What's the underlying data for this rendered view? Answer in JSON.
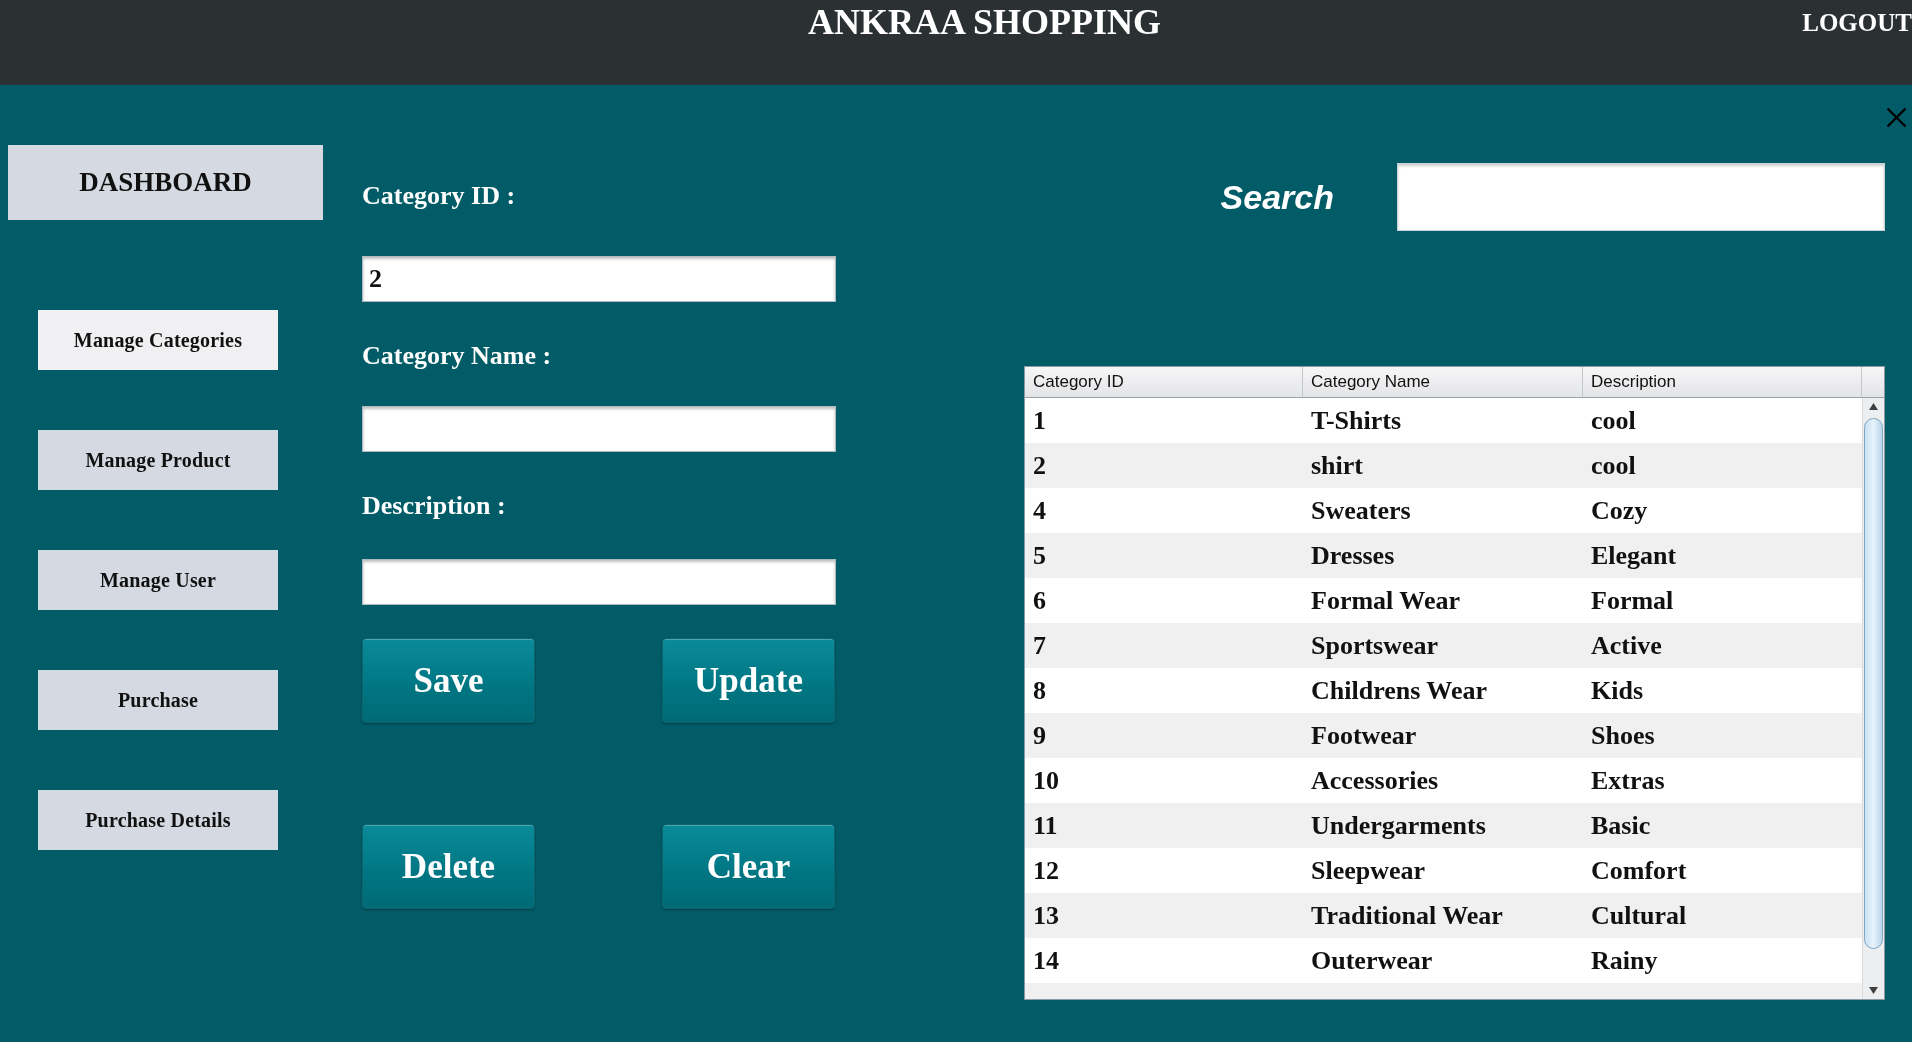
{
  "header": {
    "title": "ANKRAA SHOPPING",
    "logout": "LOGOUT"
  },
  "sidebar": {
    "dashboard": "DASHBOARD",
    "items": [
      {
        "label": "Manage Categories",
        "selected": true
      },
      {
        "label": "Manage Product",
        "selected": false
      },
      {
        "label": "Manage User",
        "selected": false
      },
      {
        "label": "Purchase",
        "selected": false
      },
      {
        "label": "Purchase Details",
        "selected": false
      }
    ]
  },
  "form": {
    "fields": [
      {
        "label": "Category ID :",
        "value": "2"
      },
      {
        "label": "Category Name :"
      },
      {
        "label": "Description :"
      }
    ],
    "buttons": [
      "Save",
      "Update",
      "Delete",
      "Clear"
    ]
  },
  "search": {
    "label": "Search"
  },
  "table": {
    "columns": [
      "Category ID",
      "Category Name",
      "Description"
    ],
    "rows": [
      [
        "1",
        "T-Shirts",
        "cool"
      ],
      [
        "2",
        "shirt",
        "cool"
      ],
      [
        "4",
        "Sweaters",
        "Cozy"
      ],
      [
        "5",
        "Dresses",
        "Elegant"
      ],
      [
        "6",
        "Formal Wear",
        "Formal"
      ],
      [
        "7",
        "Sportswear",
        "Active"
      ],
      [
        "8",
        "Childrens Wear",
        "Kids"
      ],
      [
        "9",
        "Footwear",
        "Shoes"
      ],
      [
        "10",
        "Accessories",
        "Extras"
      ],
      [
        "11",
        "Undergarments",
        "Basic"
      ],
      [
        "12",
        "Sleepwear",
        "Comfort"
      ],
      [
        "13",
        "Traditional Wear",
        "Cultural"
      ],
      [
        "14",
        "Outerwear",
        "Rainy"
      ]
    ]
  }
}
